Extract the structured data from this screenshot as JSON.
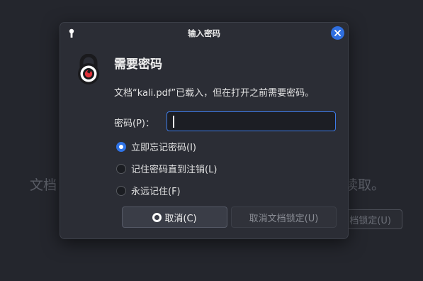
{
  "background": {
    "text_left": "文档",
    "text_right": "读取。",
    "button_label": "档锁定(U)"
  },
  "dialog": {
    "title": "输入密码",
    "heading": "需要密码",
    "message": "文档“kali.pdf”已载入，但在打开之前需要密码。",
    "password_label": "密码(P)：",
    "password_value": "",
    "options": [
      {
        "label": "立即忘记密码(I)",
        "selected": true
      },
      {
        "label": "记住密码直到注销(L)",
        "selected": false
      },
      {
        "label": "永远记住(F)",
        "selected": false
      }
    ],
    "cancel_label": "取消(C)",
    "unlock_label": "取消文档锁定(U)"
  },
  "colors": {
    "accent": "#2f73e6",
    "lock_red": "#e0323a",
    "background": "#24262d",
    "dialog": "#2b2d35"
  },
  "icons": {
    "title": "lock-icon",
    "close": "close-icon",
    "main": "padlock-icon",
    "cancel": "cancel-circle-icon"
  }
}
